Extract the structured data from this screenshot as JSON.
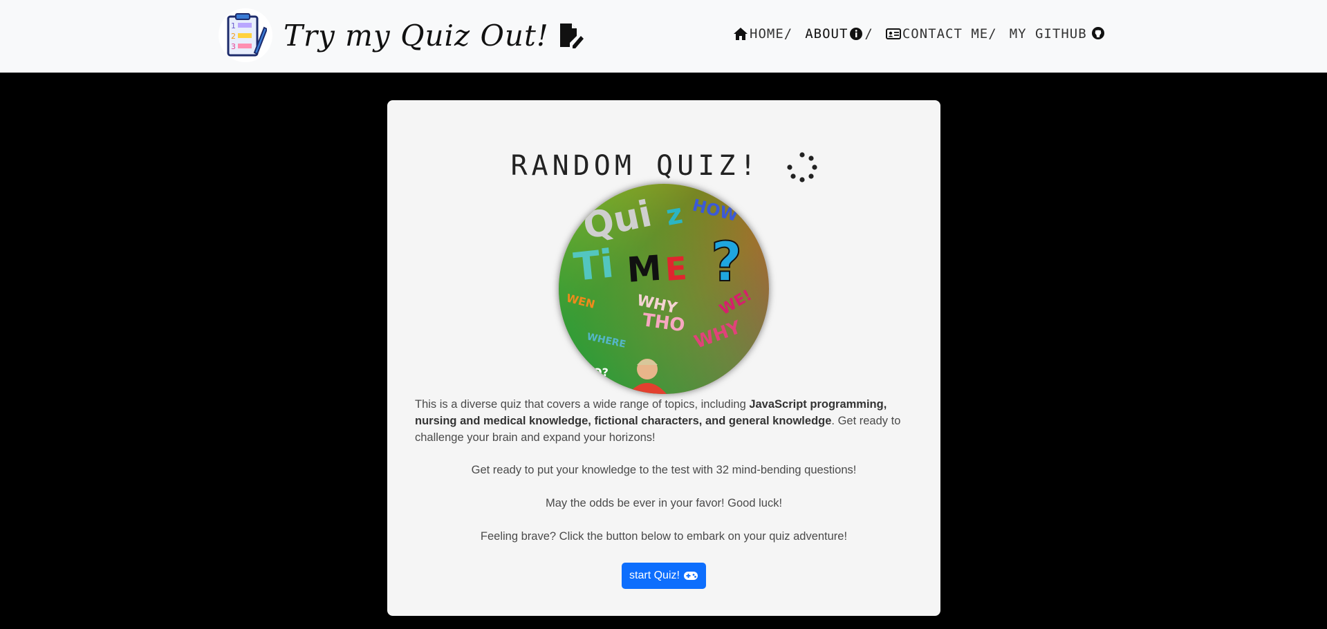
{
  "navbar": {
    "brand_title": "Try my Quiz Out!",
    "logo_icon": "quiz-list-clipboard-icon",
    "edit_icon": "file-pen-icon",
    "items": [
      {
        "label": "HOME/",
        "icon": "house-icon"
      },
      {
        "label_pre": "ABOUT",
        "label_post": "/",
        "icon": "info-circle-icon"
      },
      {
        "label": "CONTACT ME/",
        "icon": "address-card-icon"
      },
      {
        "label": "MY GITHUB",
        "icon": "github-icon"
      }
    ]
  },
  "main": {
    "title": "RANDOM QUIZ!",
    "title_icon": "spinner-icon",
    "hero_image": "quiz-time-image",
    "intro_pre": "This is a diverse quiz that covers a wide range of topics, including ",
    "intro_bold": "JavaScript programming, nursing and medical knowledge, fictional characters, and general knowledge",
    "intro_post": ". Get ready to challenge your brain and expand your horizons!",
    "line1": "Get ready to put your knowledge to the test with 32 mind-bending questions!",
    "line2": "May the odds be ever in your favor! Good luck!",
    "line3": "Feeling brave? Click the button below to embark on your quiz adventure!",
    "start_button": "start Quiz!",
    "start_button_icon": "gamepad-icon"
  },
  "colors": {
    "navbar_bg": "#f8f9fa",
    "page_bg": "#000000",
    "card_bg": "#f5f5f5",
    "button_bg": "#0d6efd"
  }
}
